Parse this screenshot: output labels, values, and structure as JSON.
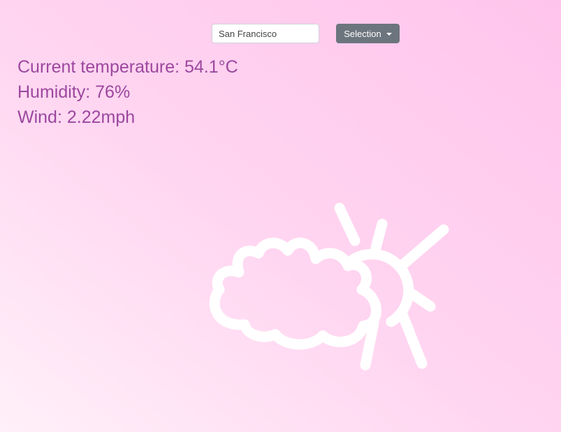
{
  "search": {
    "value": "San Francisco"
  },
  "dropdown": {
    "label": "Selection"
  },
  "weather": {
    "temperature": "Current temperature: 54.1°C",
    "humidity": "Humidity: 76%",
    "wind": "Wind: 2.22mph"
  },
  "illustration": {
    "icon": "partly-cloudy-icon"
  },
  "colors": {
    "text": "#9c479e",
    "button": "#6c757d",
    "illustration": "#ffffff",
    "background_light": "#fff0f9",
    "background_dark": "#ffc4ec"
  }
}
